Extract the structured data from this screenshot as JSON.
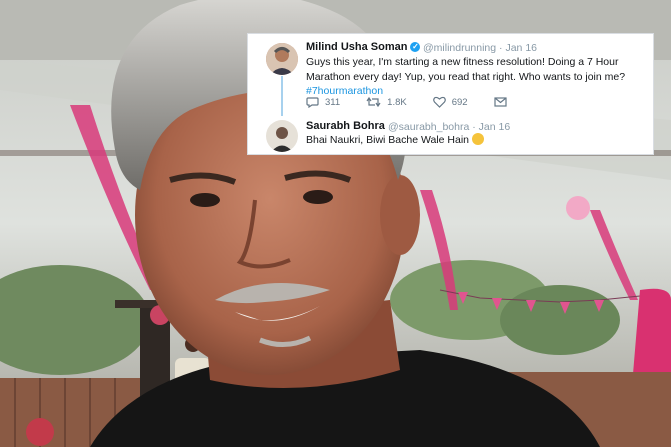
{
  "tweet": {
    "author_name": "Milind Usha Soman",
    "author_handle": "@milindrunning",
    "date": "Jan 16",
    "text": "Guys this year, I'm starting a new fitness resolution! Doing a 7 Hour Marathon every day! Yup, you read that right. Who wants to join me?",
    "hashtag": "#7hourmarathon",
    "replies": "311",
    "retweets": "1.8K",
    "likes": "692"
  },
  "reply": {
    "author_name": "Saurabh Bohra",
    "author_handle": "@saurabh_bohra",
    "date": "Jan 16",
    "text": "Bhai Naukri, Biwi Bache Wale Hain",
    "emoji": "smirking-face"
  },
  "colors": {
    "link": "#1b95e0",
    "verified": "#1da1f2",
    "muted": "#8899a6",
    "text": "#14171a"
  },
  "icons": {
    "reply": "reply-icon",
    "retweet": "retweet-icon",
    "like": "heart-icon",
    "message": "envelope-icon",
    "verified": "verified-badge-icon"
  }
}
